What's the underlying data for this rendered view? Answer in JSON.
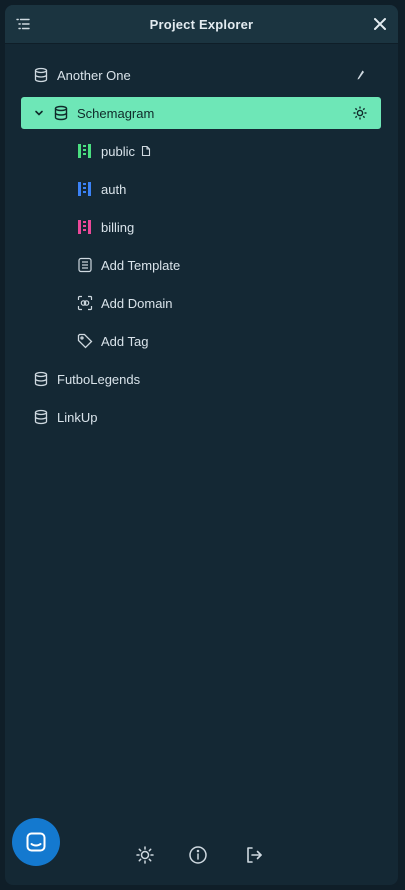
{
  "header": {
    "title": "Project Explorer"
  },
  "projects": [
    {
      "label": "Another One"
    },
    {
      "label": "Schemagram"
    },
    {
      "label": "FutboLegends"
    },
    {
      "label": "LinkUp"
    }
  ],
  "schemas": [
    {
      "label": "public",
      "color": "#4ade80"
    },
    {
      "label": "auth",
      "color": "#3b82f6"
    },
    {
      "label": "billing",
      "color": "#ec4899"
    }
  ],
  "actions": {
    "add_template": "Add Template",
    "add_domain": "Add Domain",
    "add_tag": "Add Tag"
  },
  "colors": {
    "selected": "#6ee7b7",
    "panel": "#142834",
    "chat": "#1479cf"
  }
}
